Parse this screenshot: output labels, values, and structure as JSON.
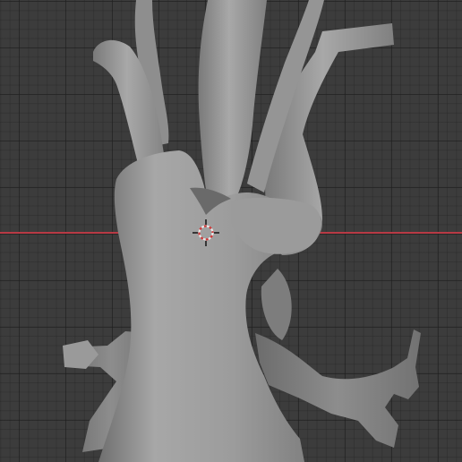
{
  "viewport": {
    "mode": "3d-viewport",
    "object": "vessel-mesh",
    "colors": {
      "background": "#3c3c3c",
      "grid_major": "#2a2a2a",
      "x_axis": "#b83a45",
      "mesh_light": "#a9a9a9",
      "mesh_mid": "#8f8f8f",
      "mesh_shadow": "#5d5d5d"
    },
    "cursor_icon": "3d-cursor-icon"
  }
}
